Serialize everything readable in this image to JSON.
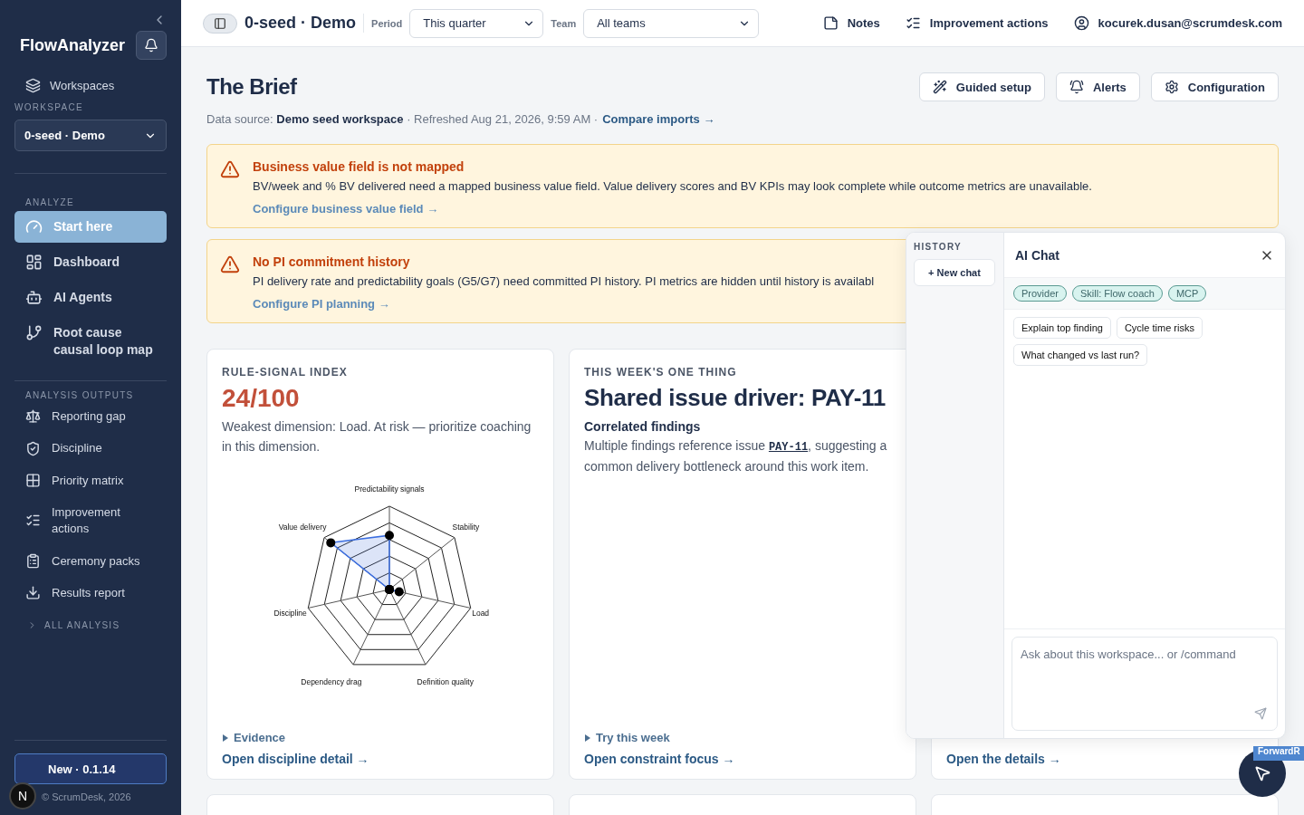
{
  "sidebar": {
    "brand": "FlowAnalyzer",
    "workspaces_link": "Workspaces",
    "workspace_label": "WORKSPACE",
    "workspace_value": "0-seed · Demo",
    "sections": [
      {
        "title": "ANALYZE",
        "items": [
          {
            "label": "Start here",
            "selected": true
          },
          {
            "label": "Dashboard",
            "selected": false
          },
          {
            "label": "AI Agents",
            "selected": false
          },
          {
            "label": "Root cause causal loop map",
            "selected": false
          }
        ]
      },
      {
        "title": "ANALYSIS OUTPUTS",
        "items": [
          {
            "label": "Reporting gap",
            "selected": false
          },
          {
            "label": "Discipline",
            "selected": false
          },
          {
            "label": "Priority matrix",
            "selected": false
          },
          {
            "label": "Improvement actions",
            "selected": false
          },
          {
            "label": "Ceremony packs",
            "selected": false
          },
          {
            "label": "Results report",
            "selected": false
          }
        ]
      }
    ],
    "all_analysis": {
      "label": "ALL ANALYSIS",
      "expanded": false
    },
    "release_button": "New · 0.1.14",
    "footer": "© ScrumDesk, 2026",
    "dev_badge": "N"
  },
  "topbar": {
    "sidebar_toggle_on": true,
    "title": "0-seed · Demo",
    "period_label": "Period",
    "period_value": "This quarter",
    "team_label": "Team",
    "team_value": "All teams",
    "links": [
      "Notes",
      "Improvement actions",
      "kocurek.dusan@scrumdesk.com"
    ]
  },
  "header": {
    "title": "The Brief",
    "actions": [
      "Guided setup",
      "Alerts",
      "Configuration"
    ],
    "meta": "Data source: **Demo seed workspace** · Refreshed Aug 21, 2026, 9:59 AM ·",
    "meta_link": "Compare imports →"
  },
  "alerts": [
    {
      "kind": "warning",
      "title": "Business value field is not mapped",
      "message": "BV/week and % BV delivered need a mapped business value field. Value delivery scores and BV KPIs may look complete while outcome metrics are unavailable.",
      "link": "Configure business value field →"
    },
    {
      "kind": "warning",
      "title": "No PI commitment history",
      "message": "PI delivery rate and predictability goals (G5/G7) need committed PI history. PI metrics are hidden until history is availabl",
      "link": "Configure PI planning →"
    }
  ],
  "cards": [
    {
      "kind": "score",
      "eyebrow": "RULE-SIGNAL INDEX",
      "score": "24/100",
      "text": "Weakest dimension: Load. At risk — prioritize coaching in this dimension.",
      "radar_axes": [
        "Predictability signals",
        "Value delivery",
        "Stability",
        "Discipline",
        "Load",
        "Dependency drag",
        "Definition quality"
      ],
      "disclosure": {
        "label": "Evidence",
        "expanded": false
      },
      "link": "Open discipline detail →"
    },
    {
      "kind": "focus",
      "eyebrow": "THIS WEEK'S ONE THING",
      "title": "Shared issue driver: PAY-11",
      "subtitle": "Correlated findings",
      "text": "Multiple findings reference issue **PAY-11**, suggesting a common delivery bottleneck around this work item.",
      "disclosure": {
        "label": "Try this week",
        "expanded": false
      },
      "link": "Open constraint focus →"
    },
    {
      "kind": "link",
      "link": "Open the details →"
    }
  ],
  "chat": {
    "history_label": "HISTORY",
    "new_chat": "+ New chat",
    "title": "AI Chat",
    "chips": [
      "Provider",
      "Skill: Flow coach",
      "MCP"
    ],
    "suggestions": [
      "Explain top finding",
      "Cycle time risks",
      "What changed vs last run?"
    ],
    "placeholder": "Ask about this workspace... or /command"
  },
  "overlay_badge": {
    "label": "ForwardR"
  }
}
